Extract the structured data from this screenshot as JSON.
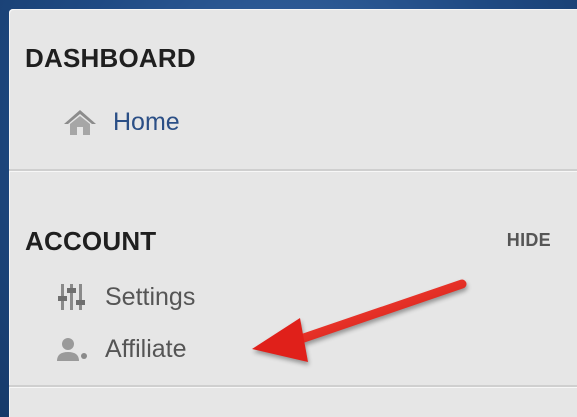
{
  "dashboard": {
    "title": "DASHBOARD",
    "items": [
      {
        "label": "Home",
        "icon": "home-icon",
        "color": "#2b4f86"
      }
    ]
  },
  "account": {
    "title": "ACCOUNT",
    "hide_label": "HIDE",
    "items": [
      {
        "label": "Settings",
        "icon": "sliders-icon",
        "color": "#555555"
      },
      {
        "label": "Affiliate",
        "icon": "user-icon",
        "color": "#555555"
      }
    ]
  },
  "annotation": {
    "kind": "red-arrow",
    "points_to": "Affiliate",
    "color": "#e0201a"
  }
}
